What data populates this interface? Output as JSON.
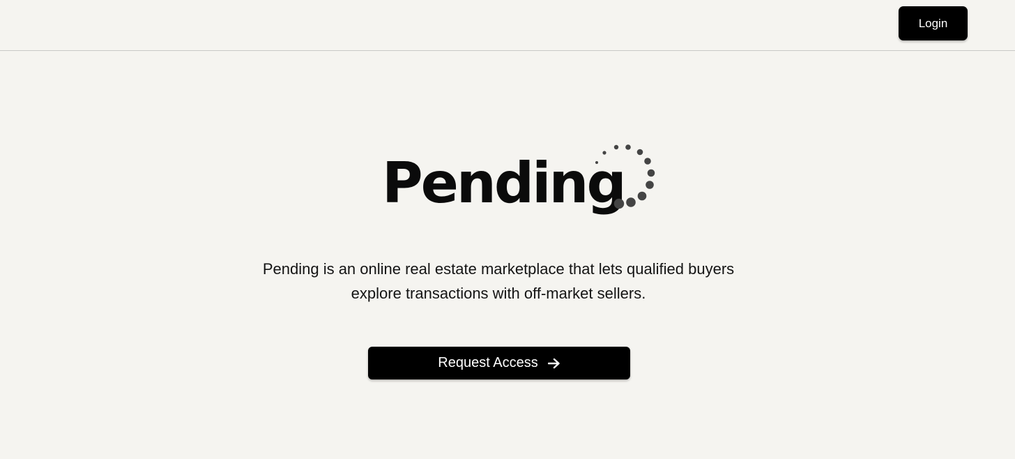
{
  "header": {
    "login_label": "Login"
  },
  "hero": {
    "logo_text": "Pending",
    "tagline_line1": "Pending is an online real estate marketplace that lets qualified buyers",
    "tagline_line2": "explore transactions with off-market sellers.",
    "cta_label": "Request Access",
    "cta_icon": "arrow-right-icon"
  },
  "colors": {
    "background": "#f5f4f0",
    "button": "#000000",
    "button_text": "#ffffff",
    "logo_dots": "#444444"
  }
}
